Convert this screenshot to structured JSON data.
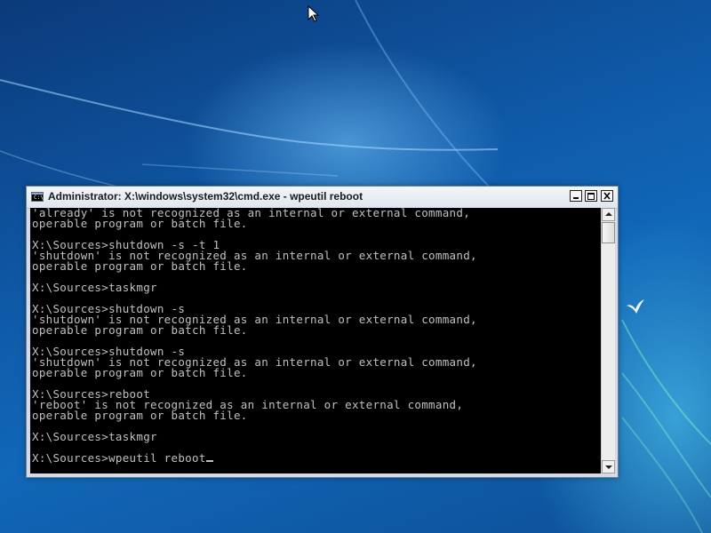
{
  "window": {
    "title": "Administrator: X:\\windows\\system32\\cmd.exe - wpeutil  reboot",
    "icon": "cmd-icon",
    "icon_text": "C:\\."
  },
  "console": {
    "lines": [
      "'already' is not recognized as an internal or external command,",
      "operable program or batch file.",
      "",
      "X:\\Sources>shutdown -s -t 1",
      "'shutdown' is not recognized as an internal or external command,",
      "operable program or batch file.",
      "",
      "X:\\Sources>taskmgr",
      "",
      "X:\\Sources>shutdown -s",
      "'shutdown' is not recognized as an internal or external command,",
      "operable program or batch file.",
      "",
      "X:\\Sources>shutdown -s",
      "'shutdown' is not recognized as an internal or external command,",
      "operable program or batch file.",
      "",
      "X:\\Sources>reboot",
      "'reboot' is not recognized as an internal or external command,",
      "operable program or batch file.",
      "",
      "X:\\Sources>taskmgr",
      "",
      "X:\\Sources>wpeutil reboot"
    ],
    "text_color": "#c0c0c0",
    "background_color": "#000000"
  },
  "titlebar_buttons": {
    "minimize": "minimize-icon",
    "maximize": "maximize-icon",
    "close": "close-icon"
  },
  "desktop": {
    "background_color": "#1167b8"
  }
}
